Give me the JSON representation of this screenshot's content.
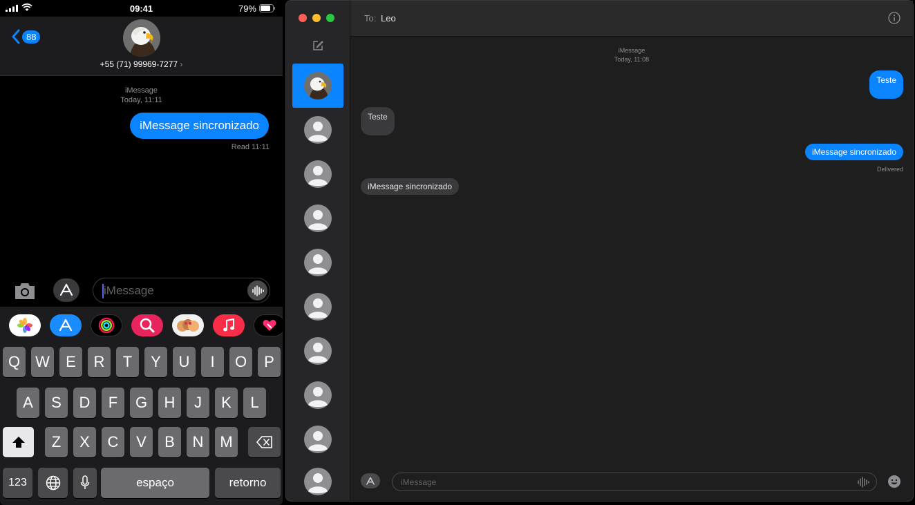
{
  "phone": {
    "status": {
      "time": "09:41",
      "battery": "79%"
    },
    "header": {
      "back_count": "88",
      "contact_number": "+55 (71) 99969-7277",
      "chevron": "›"
    },
    "thread": {
      "service": "iMessage",
      "timestamp": "Today, 11:11",
      "messages": [
        {
          "direction": "outgoing",
          "text": "iMessage sincronizado"
        }
      ],
      "receipt": "Read 11:11"
    },
    "input": {
      "placeholder": "iMessage"
    },
    "app_strip": [
      "photos-app-icon",
      "app-store-icon",
      "activity-app-icon",
      "search-images-app-icon",
      "memoji-stickers-icon",
      "music-app-icon",
      "digital-touch-icon"
    ],
    "keyboard": {
      "row1": [
        "Q",
        "W",
        "E",
        "R",
        "T",
        "Y",
        "U",
        "I",
        "O",
        "P"
      ],
      "row2": [
        "A",
        "S",
        "D",
        "F",
        "G",
        "H",
        "J",
        "K",
        "L"
      ],
      "row3": [
        "Z",
        "X",
        "C",
        "V",
        "B",
        "N",
        "M"
      ],
      "numbers": "123",
      "space": "espaço",
      "return": "retorno"
    }
  },
  "mac": {
    "header": {
      "to_label": "To:",
      "to_name": "Leo"
    },
    "thread": {
      "service": "iMessage",
      "timestamp": "Today, 11:08",
      "messages": [
        {
          "direction": "outgoing",
          "text": "Teste"
        },
        {
          "direction": "incoming",
          "text": "Teste"
        },
        {
          "direction": "outgoing",
          "text": "iMessage sincronizado"
        },
        {
          "direction": "incoming",
          "text": "iMessage sincronizado"
        }
      ],
      "receipt": "Delivered"
    },
    "input": {
      "placeholder": "iMessage"
    },
    "colors": {
      "accent": "#0a84ff",
      "incoming_bubble": "#3a3a3c",
      "close": "#ff5f57",
      "minimize": "#febc2e",
      "zoom": "#28c840"
    }
  }
}
